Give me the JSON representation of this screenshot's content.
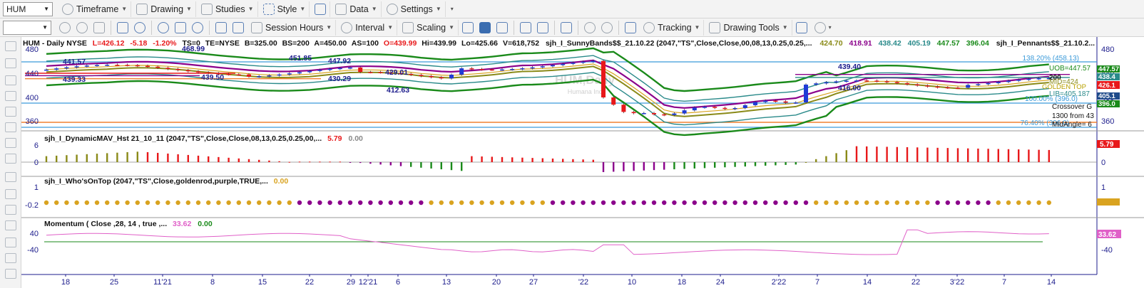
{
  "toolbar1": {
    "symbol": "HUM",
    "timeframe": "Timeframe",
    "drawing": "Drawing",
    "studies": "Studies",
    "style": "Style",
    "data": "Data",
    "settings": "Settings"
  },
  "toolbar2": {
    "session_hours": "Session Hours",
    "interval": "Interval",
    "scaling": "Scaling",
    "tracking": "Tracking",
    "drawing_tools": "Drawing Tools"
  },
  "price_header": {
    "symbol_desc": "HUM - Daily  NYSE",
    "last": "L=426.12",
    "change": "-5.18",
    "change_pct": "-1.20%",
    "ts": "TS=0",
    "te": "TE=NYSE",
    "bid": "B=325.00",
    "bs": "BS=200",
    "ask": "A=450.00",
    "as": "AS=100",
    "open": "O=439.99",
    "high": "Hi=439.99",
    "low": "Lo=425.66",
    "volume": "V=618,752",
    "study1": "sjh_I_SunnyBands$$_21.10.22 (2047,\"TS\",Close,Close,00,08,13,0.25,0.25,...",
    "study1_values": [
      "424.70",
      "418.91",
      "438.42",
      "405.19",
      "447.57",
      "396.04"
    ],
    "study2": "sjh_I_Pennants$$_21.10.2..."
  },
  "watermark": {
    "title": "HUM,Daily",
    "subtitle": "Humana Inc"
  },
  "panes": {
    "macd_label": "sjh_I_DynamicMAV_Hst 21_10_11 (2047,\"TS\",Close,Close,08,13,0.25,0.25,00,...",
    "macd_v1": "5.79",
    "macd_v2": "0.00",
    "wot_label": "sjh_I_Who'sOnTop (2047,\"TS\",Close,goldenrod,purple,TRUE,...",
    "wot_v1": "0.00",
    "mom_label": "Momentum ( Close ,28, 14 , true ,...",
    "mom_v1": "33.62",
    "mom_v2": "0.00"
  },
  "price_axis": {
    "ticks": [
      "480",
      "440",
      "400",
      "360"
    ],
    "tags": [
      "447.57",
      "438.4",
      "426.1",
      "405.1",
      "396.0"
    ],
    "fib_top": "138.20% (458.13)",
    "fib_mid": "100.00% (396.0)",
    "fib_bottom": "76.40% (396.0)"
  },
  "right_labels": {
    "uob": "UOB=447.57",
    "mid": "MID=424",
    "golden": "GOLDEN TOP",
    "lib": "LIB=405.187",
    "cross": "Crossover G",
    "from": "1300 from 43",
    "midangle": "MidAngle= 6",
    "num200": "200"
  },
  "pane_axis": {
    "macd": [
      "6",
      "0"
    ],
    "macd_tag": "5.79",
    "wot": [
      "1",
      "-0.2"
    ],
    "mom": [
      "40",
      "-40"
    ],
    "mom_tag": "33.62"
  },
  "price_labels": [
    "468.99",
    "441.57",
    "439.33",
    "439.50",
    "451.85",
    "447.92",
    "430.29",
    "429.01",
    "412.63",
    "439.40",
    "416.00"
  ],
  "time_axis": [
    "18",
    "25",
    "11'21",
    "8",
    "15",
    "22",
    "29",
    "12'21",
    "6",
    "13",
    "20",
    "27",
    "'22",
    "10",
    "18",
    "24",
    "2'22",
    "7",
    "14",
    "22",
    "3'22",
    "7",
    "14"
  ],
  "colors": {
    "up_bar": "#1f3bd6",
    "down_bar": "#e8181a",
    "band_green": "#1a8a1a",
    "band_purple": "#8b008b",
    "olive": "#8a8a18",
    "goldenrod": "#d9a320",
    "momentum": "#e060c8",
    "fib_blue": "#3a9ad9",
    "orange_line": "#f08030"
  }
}
